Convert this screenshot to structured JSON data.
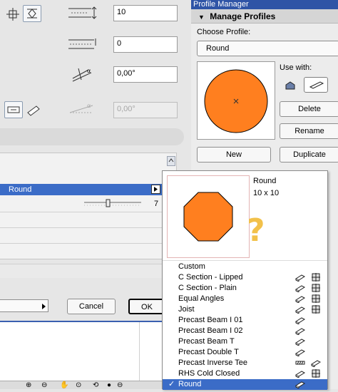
{
  "settings": {
    "height_value": "10",
    "offset_value": "0",
    "angle_value": "0,00°",
    "angle2_value": "0,00°",
    "profile_row_label": "Round",
    "slider_value": "7",
    "cancel_label": "Cancel",
    "ok_label": "OK"
  },
  "profile_manager": {
    "title": "Profile Manager",
    "section_header": "Manage Profiles",
    "choose_label": "Choose Profile:",
    "selected_profile": "Round",
    "use_with_label": "Use with:",
    "delete_label": "Delete",
    "rename_label": "Rename",
    "new_label": "New",
    "duplicate_label": "Duplicate"
  },
  "popup": {
    "preview_name": "Round",
    "preview_size": "10 x 10",
    "items": [
      {
        "label": "Custom",
        "icons": []
      },
      {
        "label": "C Section - Lipped",
        "icons": [
          "beam",
          "column"
        ]
      },
      {
        "label": "C Section - Plain",
        "icons": [
          "beam",
          "column"
        ]
      },
      {
        "label": "Equal Angles",
        "icons": [
          "beam",
          "column"
        ]
      },
      {
        "label": "Joist",
        "icons": [
          "beam",
          "column"
        ]
      },
      {
        "label": "Precast Beam I 01",
        "icons": [
          "beam"
        ]
      },
      {
        "label": "Precast Beam I 02",
        "icons": [
          "beam"
        ]
      },
      {
        "label": "Precast Beam T",
        "icons": [
          "beam"
        ]
      },
      {
        "label": "Precast Double T",
        "icons": [
          "beam"
        ]
      },
      {
        "label": "Precast Inverse Tee",
        "icons": [
          "hatch",
          "beam"
        ]
      },
      {
        "label": "RHS Cold Closed",
        "icons": [
          "beam",
          "column"
        ]
      },
      {
        "label": "Round",
        "icons": [
          "beam"
        ],
        "selected": true
      }
    ]
  },
  "colors": {
    "profile_fill": "#ff7f1f",
    "selection": "#3b6cc7",
    "title_bar": "#2f54a6",
    "question_mark": "#f2c14a"
  }
}
